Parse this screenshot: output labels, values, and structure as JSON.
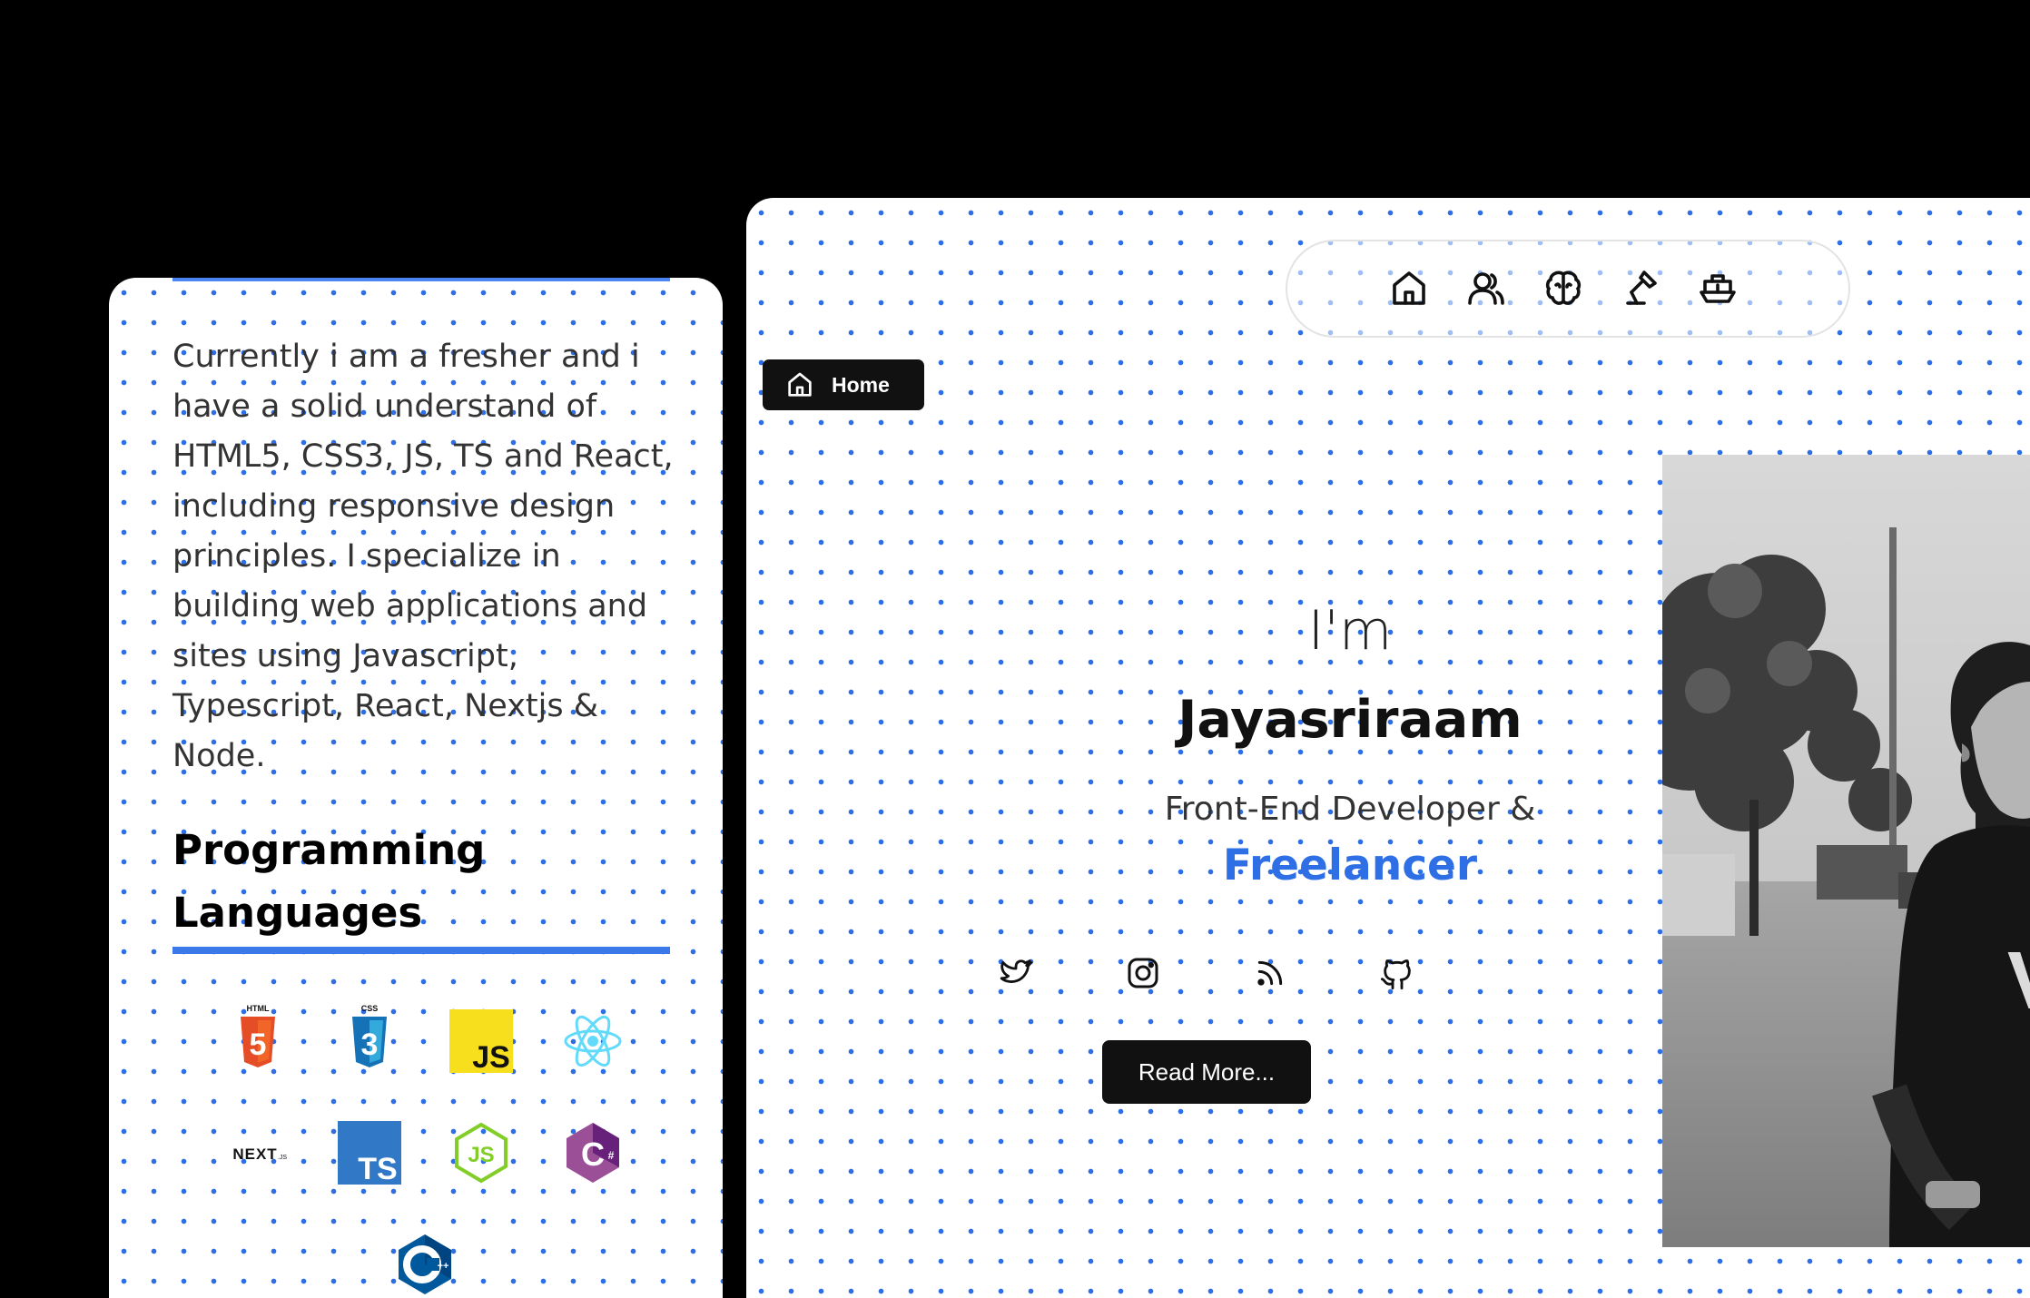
{
  "about": {
    "paragraph": "Currently i am a fresher and i have a solid understand of HTML5, CSS3, JS, TS and React, including responsive design principles. I specialize in building web applications and sites using Javascript, Typescript, React, Nextjs & Node.",
    "skills_title": "Programming Languages",
    "skills": [
      {
        "icon": "html5-icon",
        "label": "HTML",
        "color": "#e44d26"
      },
      {
        "icon": "css3-icon",
        "label": "CSS",
        "color": "#1572b6"
      },
      {
        "icon": "javascript-icon",
        "label": "JS",
        "color": "#f7df1e"
      },
      {
        "icon": "react-icon",
        "color": "#61dafb"
      },
      {
        "icon": "nextjs-icon",
        "label": "NEXT.js",
        "color": "#000000"
      },
      {
        "icon": "typescript-icon",
        "label": "TS",
        "color": "#3178c6"
      },
      {
        "icon": "nodejs-icon",
        "label": "JS",
        "color": "#83cd29"
      },
      {
        "icon": "csharp-icon",
        "label": "C#",
        "color": "#9b4f96"
      },
      {
        "icon": "cplusplus-icon",
        "label": "C++",
        "color": "#00599c"
      }
    ]
  },
  "nav": {
    "items": [
      "home-icon",
      "users-icon",
      "brain-icon",
      "lamp-icon",
      "ship-icon"
    ],
    "home_label": "Home"
  },
  "hero": {
    "intro": "I'm",
    "name": "Jayasriraam",
    "role": "Front-End Developer &",
    "accent": "Freelancer",
    "accent_color": "#2f6fe6",
    "social": [
      "twitter-icon",
      "instagram-icon",
      "rss-icon",
      "github-icon"
    ],
    "cta": "Read More..."
  },
  "theme": {
    "dot_color": "#2f6fe6",
    "rule_color": "#3b78e8",
    "dark": "#111111"
  }
}
